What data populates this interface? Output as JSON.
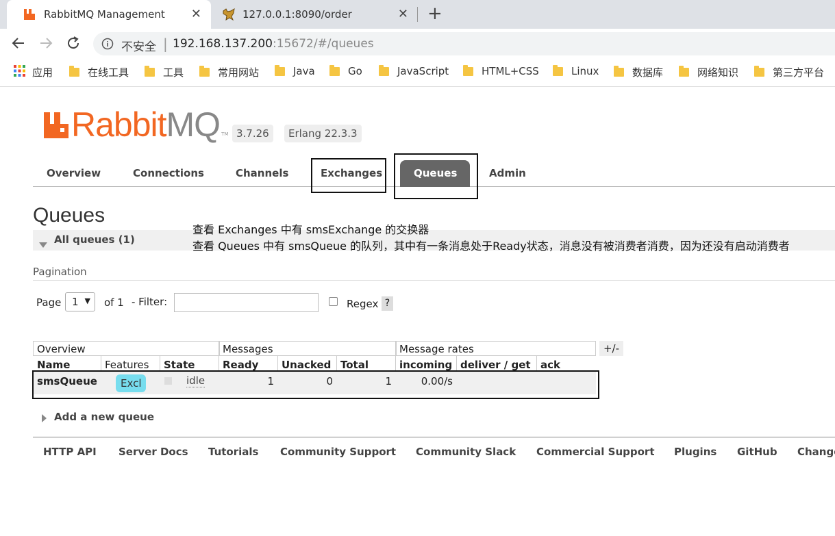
{
  "browser": {
    "tabs": [
      {
        "title": "RabbitMQ Management",
        "active": true,
        "close": "✕"
      },
      {
        "title": "127.0.0.1:8090/order",
        "active": false,
        "close": "✕"
      }
    ],
    "new_tab": "+",
    "security_label": "不安全",
    "url_host": "192.168.137.200",
    "url_rest": ":15672/#/queues",
    "bookmarks": [
      "应用",
      "在线工具",
      "工具",
      "常用网站",
      "Java",
      "Go",
      "JavaScript",
      "HTML+CSS",
      "Linux",
      "数据库",
      "网络知识",
      "第三方平台"
    ]
  },
  "app": {
    "logo_main": "Rabbit",
    "logo_mq": "MQ",
    "logo_tm": "TM",
    "version": "3.7.26",
    "erlang": "Erlang 22.3.3",
    "nav": [
      "Overview",
      "Connections",
      "Channels",
      "Exchanges",
      "Queues",
      "Admin"
    ],
    "active_nav": "Queues"
  },
  "page": {
    "title": "Queues",
    "section": "All queues (1)",
    "annotation_line1": "查看 Exchanges 中有 smsExchange 的交换器",
    "annotation_line2": "查看 Queues 中有 smsQueue 的队列，其中有一条消息处于Ready状态，消息没有被消费者消费，因为还没有启动消费者",
    "pagination_label": "Pagination",
    "page_label": "Page",
    "page_value": "1",
    "of_label": "of 1",
    "filter_label": "- Filter:",
    "filter_value": "",
    "regex_label": "Regex",
    "help": "?",
    "plus_minus": "+/-"
  },
  "table": {
    "groups": [
      "Overview",
      "Messages",
      "Message rates"
    ],
    "columns": [
      "Name",
      "Features",
      "State",
      "Ready",
      "Unacked",
      "Total",
      "incoming",
      "deliver / get",
      "ack"
    ],
    "rows": [
      {
        "name": "smsQueue",
        "features": "Excl",
        "state": "idle",
        "ready": "1",
        "unacked": "0",
        "total": "1",
        "incoming": "0.00/s",
        "deliver_get": "",
        "ack": ""
      }
    ]
  },
  "add_queue": "Add a new queue",
  "footer": [
    "HTTP API",
    "Server Docs",
    "Tutorials",
    "Community Support",
    "Community Slack",
    "Commercial Support",
    "Plugins",
    "GitHub",
    "Changelog"
  ],
  "colors": {
    "brand": "#f26722",
    "active_tab": "#666666",
    "excl_badge": "#77ddee"
  }
}
